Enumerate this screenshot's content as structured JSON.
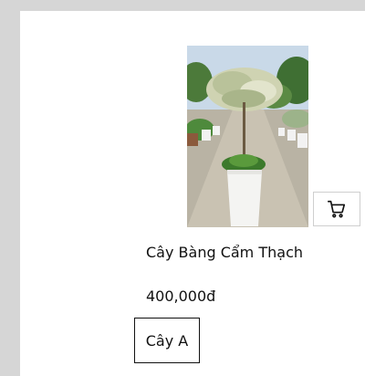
{
  "product": {
    "name": "Cây Bàng Cẩm Thạch",
    "price": "400,000đ",
    "tag": "Cây A",
    "image_icon": "potted-tree-photo",
    "cart_icon": "shopping-cart-icon"
  }
}
